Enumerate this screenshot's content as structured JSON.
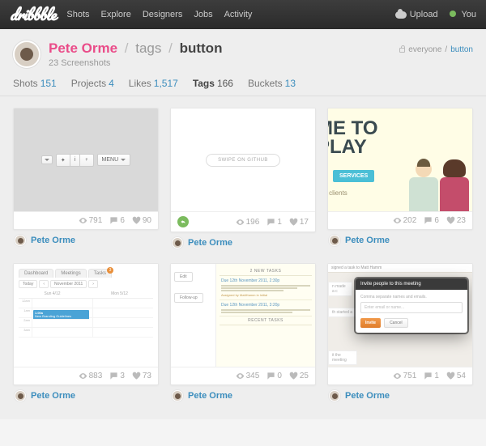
{
  "topnav": {
    "logo": "dribbble",
    "items": [
      "Shots",
      "Explore",
      "Designers",
      "Jobs",
      "Activity"
    ],
    "upload": "Upload",
    "you": "You"
  },
  "header": {
    "user": "Pete Orme",
    "section": "tags",
    "tag": "button",
    "subtitle": "23 Screenshots",
    "visibility_label": "everyone",
    "visibility_tag": "button"
  },
  "tabs": [
    {
      "label": "Shots",
      "count": "151"
    },
    {
      "label": "Projects",
      "count": "4"
    },
    {
      "label": "Likes",
      "count": "1,517"
    },
    {
      "label": "Tags",
      "count": "166",
      "active": true
    },
    {
      "label": "Buckets",
      "count": "13"
    }
  ],
  "shots": [
    {
      "author": "Pete Orme",
      "views": "791",
      "comments": "6",
      "likes": "90",
      "rebound": false,
      "preview": {
        "kind": "buttons",
        "menu_label": "MENU"
      }
    },
    {
      "author": "Pete Orme",
      "views": "196",
      "comments": "1",
      "likes": "17",
      "rebound": true,
      "preview": {
        "kind": "swipe",
        "label": "SWIPE ON GITHUB"
      }
    },
    {
      "author": "Pete Orme",
      "views": "202",
      "comments": "6",
      "likes": "23",
      "rebound": false,
      "preview": {
        "kind": "play",
        "line1": "ME TO",
        "line2": "PLAY",
        "button": "SERVICES",
        "caption": "eir clients"
      }
    },
    {
      "author": "Pete Orme",
      "views": "883",
      "comments": "3",
      "likes": "73",
      "rebound": false,
      "preview": {
        "kind": "calendar",
        "tabs": [
          "Dashboard",
          "Meetings",
          "Tasks"
        ],
        "today": "Today",
        "month": "November 2011",
        "days": [
          "Sun 4/12",
          "Mon 5/12"
        ],
        "times": [
          "12am",
          "1am",
          "2am",
          "3am"
        ],
        "event_time": "1.00a",
        "event_title": "New Branding Guidelines"
      }
    },
    {
      "author": "Pete Orme",
      "views": "345",
      "comments": "0",
      "likes": "25",
      "rebound": false,
      "preview": {
        "kind": "tasks",
        "btn1": "Edit",
        "btn2": "Follow-up",
        "header": "2 NEW TASKS",
        "date1": "Due 12th November 2011, 2:30p",
        "assigned1": "Assigned by MattHamm in Initial",
        "date2": "Due 12th November 2011, 3:20p",
        "recent_header": "RECENT TASKS"
      }
    },
    {
      "author": "Pete Orme",
      "views": "751",
      "comments": "1",
      "likes": "54",
      "rebound": false,
      "preview": {
        "kind": "modal",
        "strip": "signed a task to Matt Hamm",
        "frag_a": "n made a c",
        "frag_b": "th started a",
        "frag_c": "it the meeting",
        "title": "Invite people to this meeting",
        "note": "Comma separate names and emails.",
        "placeholder": "Enter email or name...",
        "invite": "Invite",
        "cancel": "Cancel"
      }
    }
  ]
}
